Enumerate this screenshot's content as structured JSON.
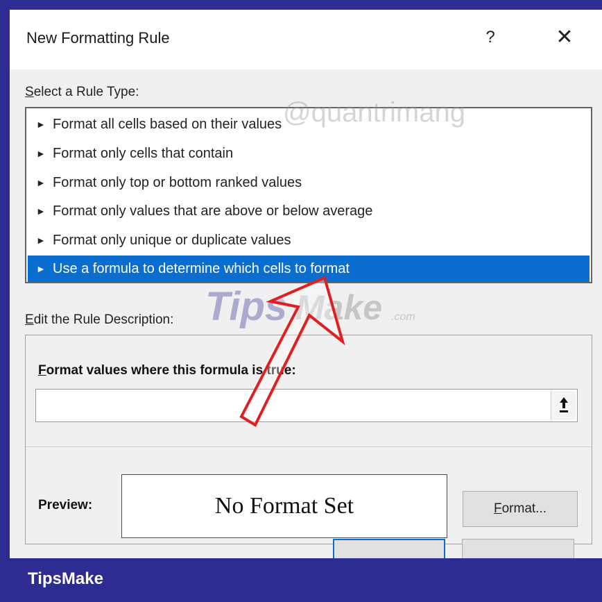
{
  "dialog": {
    "title": "New Formatting Rule",
    "help_label": "?",
    "close_label": "✕"
  },
  "rule_type": {
    "label_first": "S",
    "label_rest": "elect a Rule Type:",
    "items": [
      {
        "label": "Format all cells based on their values",
        "selected": false
      },
      {
        "label": "Format only cells that contain",
        "selected": false
      },
      {
        "label": "Format only top or bottom ranked values",
        "selected": false
      },
      {
        "label": "Format only values that are above or below average",
        "selected": false
      },
      {
        "label": "Format only unique or duplicate values",
        "selected": false
      },
      {
        "label": "Use a formula to determine which cells to format",
        "selected": true
      }
    ],
    "bullet": "►"
  },
  "description": {
    "label_first": "E",
    "label_rest": "dit the Rule Description:",
    "formula_label_first": "F",
    "formula_label_rest": "ormat values where this formula is true:",
    "formula_value": "",
    "preview_label": "Preview:",
    "preview_text": "No Format Set",
    "format_button_first": "F",
    "format_button_rest": "ormat..."
  },
  "watermarks": {
    "brand": "TipsMake",
    "overlay_1": "Tips",
    "overlay_2": "Make",
    "overlay_3": ".com",
    "overlay_4": "@quantrimang"
  },
  "colors": {
    "frame": "#2c2c93",
    "selection": "#0a6ed1",
    "annotation_arrow": "#e02020"
  },
  "icons": {
    "collapse": "upload-arrow-icon",
    "annotation": "red-arrow-icon"
  }
}
